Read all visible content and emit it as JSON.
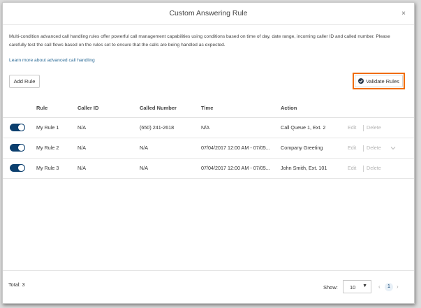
{
  "dialog": {
    "title": "Custom Answering Rule",
    "close_label": "×"
  },
  "description": "Multi-condition advanced call handling rules offer powerful call management capabilities using conditions based on time of day, date range, incoming caller ID and called number. Please carefully test the call flows based on the rules set to ensure that the calls are being handled as expected.",
  "learn_more": "Learn more about advanced call handling",
  "toolbar": {
    "add_rule": "Add Rule",
    "validate_rules": "Validate Rules"
  },
  "colors": {
    "highlight": "#f06c00",
    "toggle_on": "#0b3f6e",
    "link": "#2a6a96"
  },
  "table": {
    "columns": [
      "Rule",
      "Caller ID",
      "Called Number",
      "Time",
      "Action"
    ],
    "rows": [
      {
        "enabled": true,
        "rule": "My Rule 1",
        "caller_id": "N/A",
        "called_number": "(650) 241-2618",
        "time": "N/A",
        "action": "Call Queue 1, Ext. 2",
        "edit": "Edit",
        "delete": "Delete"
      },
      {
        "enabled": true,
        "rule": "My Rule 2",
        "caller_id": "N/A",
        "called_number": "N/A",
        "time": "07/04/2017 12:00 AM - 07/05...",
        "action": "Company Greeting",
        "edit": "Edit",
        "delete": "Delete",
        "expand_icon": "chevron-down-icon"
      },
      {
        "enabled": true,
        "rule": "My Rule 3",
        "caller_id": "N/A",
        "called_number": "N/A",
        "time": "07/04/2017 12:00 AM - 07/05...",
        "action": "John Smith, Ext. 101",
        "edit": "Edit",
        "delete": "Delete"
      }
    ]
  },
  "footer": {
    "total": "Total: 3",
    "show_label": "Show:",
    "page_size": "10",
    "current_page": "1"
  }
}
